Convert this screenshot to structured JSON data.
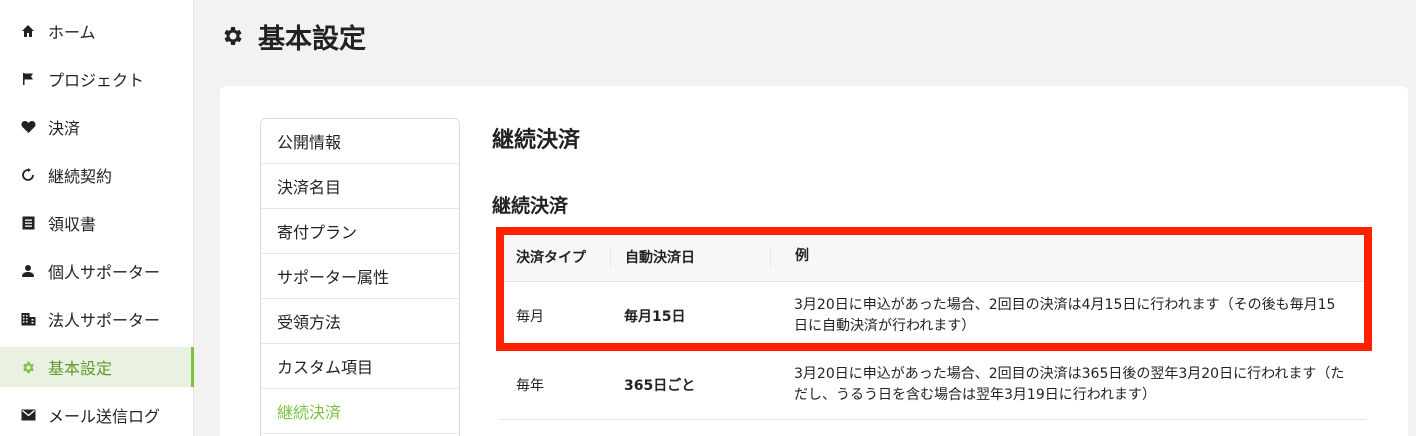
{
  "sidebar": {
    "items": [
      {
        "label": "ホーム",
        "icon": "home-icon"
      },
      {
        "label": "プロジェクト",
        "icon": "flag-icon"
      },
      {
        "label": "決済",
        "icon": "heart-icon"
      },
      {
        "label": "継続契約",
        "icon": "refresh-icon"
      },
      {
        "label": "領収書",
        "icon": "receipt-icon"
      },
      {
        "label": "個人サポーター",
        "icon": "person-icon"
      },
      {
        "label": "法人サポーター",
        "icon": "building-icon"
      },
      {
        "label": "基本設定",
        "icon": "gear-icon",
        "active": true
      },
      {
        "label": "メール送信ログ",
        "icon": "mail-icon"
      }
    ]
  },
  "header": {
    "title": "基本設定",
    "icon": "gear-icon"
  },
  "settings_menu": {
    "items": [
      "公開情報",
      "決済名目",
      "寄付プラン",
      "サポーター属性",
      "受領方法",
      "カスタム項目",
      "継続決済"
    ],
    "active": "継続決済"
  },
  "content": {
    "title": "継続決済",
    "section_title": "継続決済",
    "table": {
      "headers": [
        "決済タイプ",
        "自動決済日",
        "例"
      ],
      "rows": [
        {
          "type": "毎月",
          "day": "毎月15日",
          "example": "3月20日に申込があった場合、2回目の決済は4月15日に行われます（その後も毎月15日に自動決済が行われます）"
        },
        {
          "type": "毎年",
          "day": "365日ごと",
          "example": "3月20日に申込があった場合、2回目の決済は365日後の翌年3月20日に行われます（ただし、うるう日を含む場合は翌年3月19日に行われます）"
        }
      ]
    }
  },
  "colors": {
    "accent": "#7cc142",
    "active_bg": "#e9f1e0",
    "highlight": "#ff2200"
  }
}
